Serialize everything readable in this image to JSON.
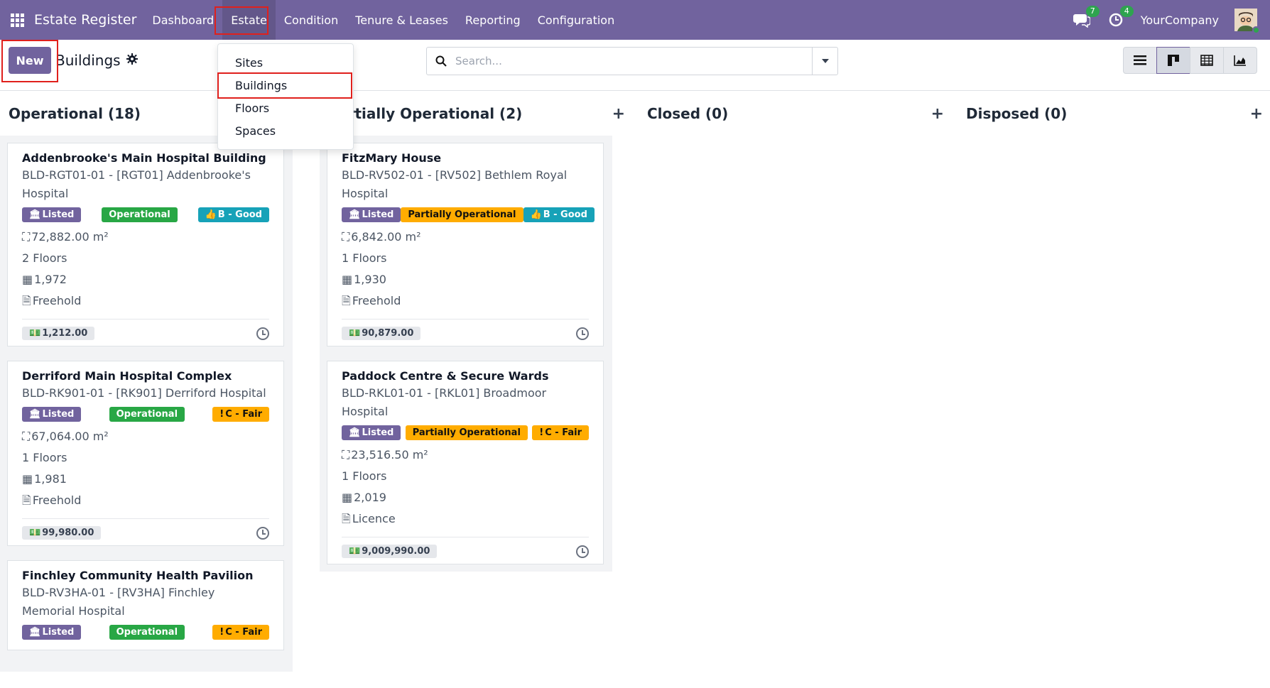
{
  "navbar": {
    "brand": "Estate Register",
    "menu": [
      "Dashboard",
      "Estate",
      "Condition",
      "Tenure & Leases",
      "Reporting",
      "Configuration"
    ],
    "messages_count": "7",
    "activities_count": "4",
    "company": "YourCompany"
  },
  "control": {
    "new_label": "New",
    "breadcrumb": "Buildings",
    "search_placeholder": "Search..."
  },
  "estate_menu": [
    "Sites",
    "Buildings",
    "Floors",
    "Spaces"
  ],
  "columns": [
    {
      "title": "Operational (18)",
      "cards": [
        {
          "name": "Addenbrooke's Main Hospital Building",
          "ref": "BLD-RGT01-01 - [RGT01] Addenbrooke's Hospital",
          "listed": "Listed",
          "status": "Operational",
          "condition": "B - Good",
          "area": "72,882.00 m²",
          "floors": "2 Floors",
          "year": "1,972",
          "tenure": "Freehold",
          "amount": "1,212.00"
        },
        {
          "name": "Derriford Main Hospital Complex",
          "ref": "BLD-RK901-01 - [RK901] Derriford Hospital",
          "listed": "Listed",
          "status": "Operational",
          "condition": "C - Fair",
          "area": "67,064.00 m²",
          "floors": "1 Floors",
          "year": "1,981",
          "tenure": "Freehold",
          "amount": "99,980.00"
        },
        {
          "name": "Finchley Community Health Pavilion",
          "ref": "BLD-RV3HA-01 - [RV3HA] Finchley Memorial Hospital",
          "listed": "Listed",
          "status": "Operational",
          "condition": "C - Fair"
        }
      ]
    },
    {
      "title": "Partially Operational (2)",
      "cards": [
        {
          "name": "FitzMary House",
          "ref": "BLD-RV502-01 - [RV502] Bethlem Royal Hospital",
          "listed": "Listed",
          "status": "Partially Operational",
          "condition": "B - Good",
          "area": "6,842.00 m²",
          "floors": "1 Floors",
          "year": "1,930",
          "tenure": "Freehold",
          "amount": "90,879.00"
        },
        {
          "name": "Paddock Centre & Secure Wards",
          "ref": "BLD-RKL01-01 - [RKL01] Broadmoor Hospital",
          "listed": "Listed",
          "status": "Partially Operational",
          "condition": "C - Fair",
          "area": "23,516.50 m²",
          "floors": "1 Floors",
          "year": "2,019",
          "tenure": "Licence",
          "amount": "9,009,990.00"
        }
      ]
    },
    {
      "title": "Closed (0)"
    },
    {
      "title": "Disposed (0)"
    }
  ],
  "icons": {
    "listed": "institution-icon",
    "good": "thumbs-up-icon",
    "fair": "exclamation-icon",
    "area": "expand-icon",
    "year": "calendar-icon",
    "tenure": "document-icon",
    "amount": "money-icon",
    "activity": "clock-icon"
  },
  "colors": {
    "brand": "#71639e",
    "operational": "#28a745",
    "partial": "#ffac00",
    "good": "#17a2b8",
    "fair": "#ffac00",
    "highlight": "#e0201c"
  }
}
